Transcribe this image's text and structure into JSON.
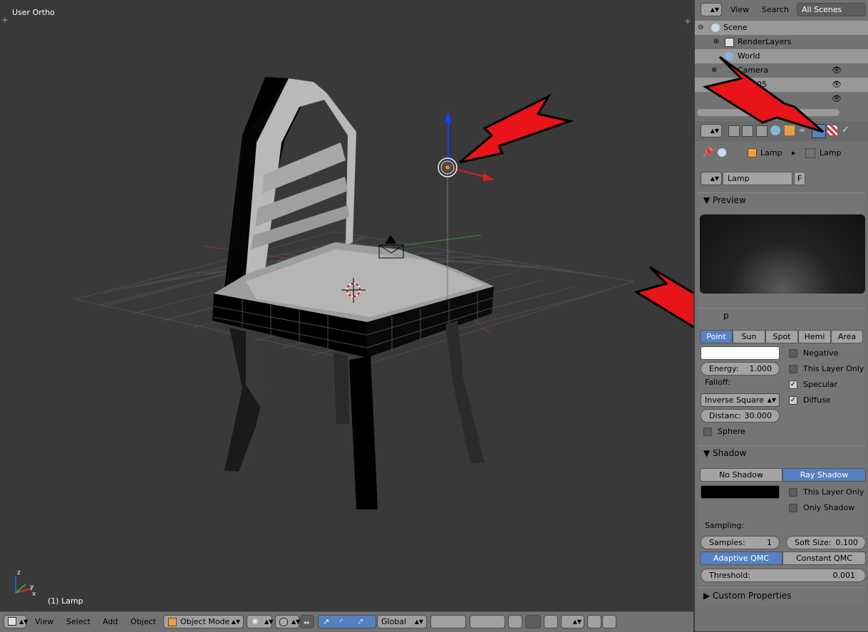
{
  "viewport": {
    "view_label": "User Ortho",
    "object_label": "(1) Lamp"
  },
  "header": {
    "menu": [
      "View",
      "Select",
      "Add",
      "Object"
    ],
    "mode": "Object Mode",
    "orientation": "Global"
  },
  "outliner": {
    "menu_view": "View",
    "menu_search": "Search",
    "scenes": "All Scenes",
    "items": [
      "Scene",
      "RenderLayers",
      "World",
      "Camera",
      "005"
    ]
  },
  "properties": {
    "breadcrumb": [
      "Lamp",
      "Lamp"
    ],
    "datablock_name": "Lamp",
    "datablock_flag": "F",
    "preview_title": "Preview",
    "lamp_title": "p",
    "lamp_types": [
      "Point",
      "Sun",
      "Spot",
      "Hemi",
      "Area"
    ],
    "energy_label": "Energy:",
    "energy_value": "1.000",
    "falloff_label": "Falloff:",
    "falloff_value": "Inverse Square",
    "distance_label": "Distanc:",
    "distance_value": "30.000",
    "sphere": "Sphere",
    "negative": "Negative",
    "this_layer_only": "This Layer Only",
    "specular": "Specular",
    "diffuse": "Diffuse",
    "shadow_title": "Shadow",
    "no_shadow": "No Shadow",
    "ray_shadow": "Ray Shadow",
    "shadow_this_layer": "This Layer Only",
    "only_shadow": "Only Shadow",
    "sampling": "Sampling:",
    "samples_label": "Samples:",
    "samples_value": "1",
    "soft_size_label": "Soft Size:",
    "soft_size_value": "0.100",
    "adaptive_qmc": "Adaptive QMC",
    "constant_qmc": "Constant QMC",
    "threshold_label": "Threshold:",
    "threshold_value": "0.001",
    "custom_properties": "Custom Properties"
  },
  "colors": {
    "accent": "#5680c2",
    "arrow": "#e8141a",
    "grid_x": "#a03030",
    "grid_y": "#3d9a3d",
    "z_axis": "#1a3cff"
  }
}
